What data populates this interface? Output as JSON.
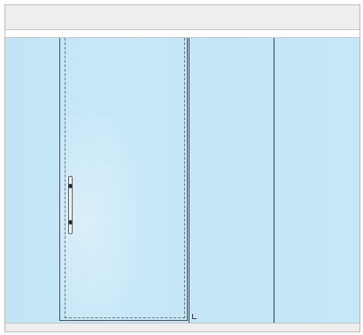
{
  "canvas": {
    "toolbar_label": "",
    "glass_color": "#c4e6f7",
    "frame_color": "#3c4248"
  },
  "panels": [
    {
      "type": "door",
      "handle": "bar-handle-icon"
    },
    {
      "type": "fixed-glass"
    },
    {
      "type": "fixed-glass"
    },
    {
      "type": "fixed-glass"
    }
  ]
}
